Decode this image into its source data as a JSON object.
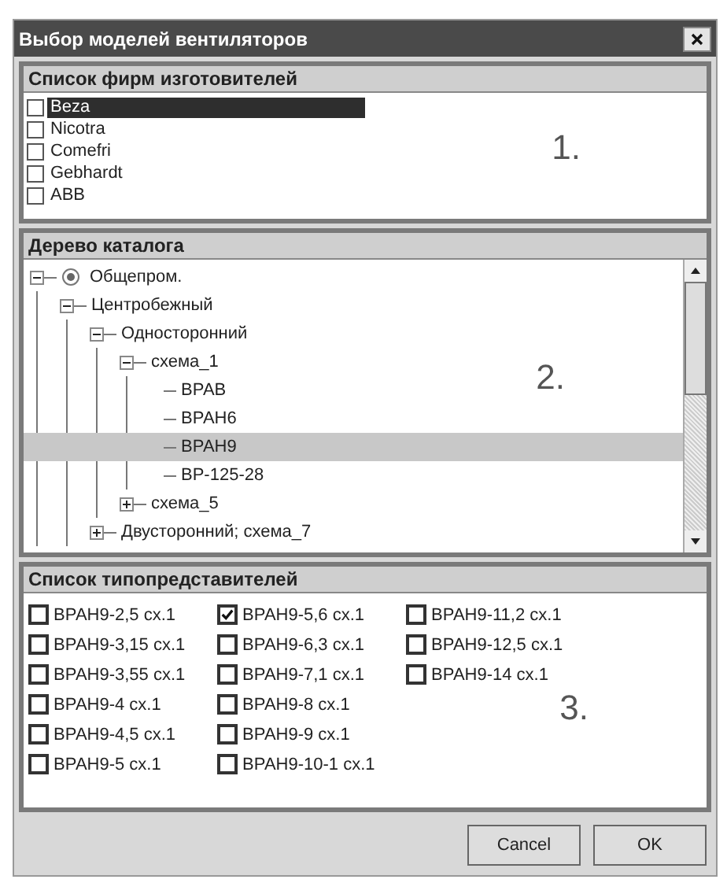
{
  "window": {
    "title": "Выбор моделей вентиляторов"
  },
  "manufacturers": {
    "title": "Список фирм изготовителей",
    "annotation": "1.",
    "items": [
      {
        "label": "Beza",
        "checked": false,
        "selected": true
      },
      {
        "label": "Nicotra",
        "checked": false,
        "selected": false
      },
      {
        "label": "Comefri",
        "checked": false,
        "selected": false
      },
      {
        "label": "Gebhardt",
        "checked": false,
        "selected": false
      },
      {
        "label": "ABB",
        "checked": false,
        "selected": false
      }
    ]
  },
  "catalog_tree": {
    "title": "Дерево каталога",
    "annotation": "2.",
    "nodes": [
      {
        "label": "Общепром.",
        "kind": "root",
        "expanded": true,
        "selected": false,
        "children": [
          {
            "label": "Центробежный",
            "expanded": true,
            "selected": false,
            "children": [
              {
                "label": "Односторонний",
                "expanded": true,
                "selected": false,
                "children": [
                  {
                    "label": "схема_1",
                    "expanded": true,
                    "selected": false,
                    "children": [
                      {
                        "label": "ВРАВ",
                        "selected": false
                      },
                      {
                        "label": "ВРАН6",
                        "selected": false
                      },
                      {
                        "label": "ВРАН9",
                        "selected": true
                      },
                      {
                        "label": "ВР-125-28",
                        "selected": false
                      }
                    ]
                  },
                  {
                    "label": "схема_5",
                    "expanded": false,
                    "selected": false
                  }
                ]
              },
              {
                "label": "Двусторонний; схема_7",
                "expanded": false,
                "selected": false
              }
            ]
          }
        ]
      }
    ]
  },
  "type_representatives": {
    "title": "Список типопредставителей",
    "annotation": "3.",
    "items": [
      {
        "label": "ВРАН9-2,5 сх.1",
        "checked": false
      },
      {
        "label": "ВРАН9-3,15 сх.1",
        "checked": false
      },
      {
        "label": "ВРАН9-3,55 сх.1",
        "checked": false
      },
      {
        "label": "ВРАН9-4 сх.1",
        "checked": false
      },
      {
        "label": "ВРАН9-4,5 сх.1",
        "checked": false
      },
      {
        "label": "ВРАН9-5 сх.1",
        "checked": false
      },
      {
        "label": "ВРАН9-5,6 сх.1",
        "checked": true
      },
      {
        "label": "ВРАН9-6,3 сх.1",
        "checked": false
      },
      {
        "label": "ВРАН9-7,1 сх.1",
        "checked": false
      },
      {
        "label": "ВРАН9-8 сх.1",
        "checked": false
      },
      {
        "label": "ВРАН9-9 сх.1",
        "checked": false
      },
      {
        "label": "ВРАН9-10-1 сх.1",
        "checked": false
      },
      {
        "label": "ВРАН9-11,2 сх.1",
        "checked": false
      },
      {
        "label": "ВРАН9-12,5 сх.1",
        "checked": false
      },
      {
        "label": "ВРАН9-14 сх.1",
        "checked": false
      }
    ]
  },
  "buttons": [
    "Cancel",
    "OK"
  ]
}
